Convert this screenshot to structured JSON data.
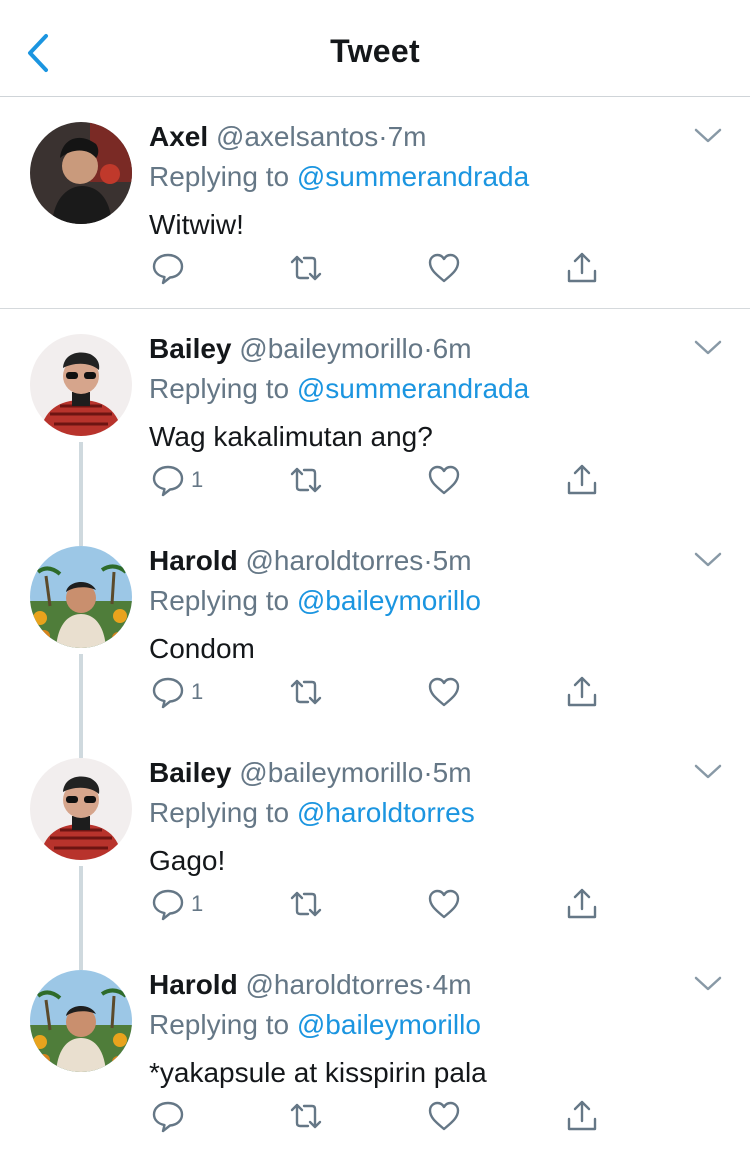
{
  "header": {
    "title": "Tweet"
  },
  "tweets": [
    {
      "name": "Axel",
      "handle": "@axelsantos",
      "dot": "·",
      "time": "7m",
      "replying_prefix": "Replying to",
      "replying_to": "@summerandrada",
      "text": "Witwiw!",
      "reply_count": ""
    },
    {
      "name": "Bailey",
      "handle": "@baileymorillo",
      "dot": "·",
      "time": "6m",
      "replying_prefix": "Replying to",
      "replying_to": "@summerandrada",
      "text": "Wag kakalimutan ang?",
      "reply_count": "1"
    },
    {
      "name": "Harold",
      "handle": "@haroldtorres",
      "dot": "·",
      "time": "5m",
      "replying_prefix": "Replying to",
      "replying_to": "@baileymorillo",
      "text": "Condom",
      "reply_count": "1"
    },
    {
      "name": "Bailey",
      "handle": "@baileymorillo",
      "dot": "·",
      "time": "5m",
      "replying_prefix": "Replying to",
      "replying_to": "@haroldtorres",
      "text": "Gago!",
      "reply_count": "1"
    },
    {
      "name": "Harold",
      "handle": "@haroldtorres",
      "dot": "·",
      "time": "4m",
      "replying_prefix": "Replying to",
      "replying_to": "@baileymorillo",
      "text": "*yakapsule at kisspirin pala",
      "reply_count": ""
    }
  ],
  "colors": {
    "accent": "#1b95e0",
    "secondary_text": "#657786",
    "divider": "#cfd4d8",
    "thread_line": "#cfd9de"
  },
  "icons": [
    "back-chevron-icon",
    "chevron-down-icon",
    "reply-icon",
    "retweet-icon",
    "like-icon",
    "share-icon"
  ]
}
